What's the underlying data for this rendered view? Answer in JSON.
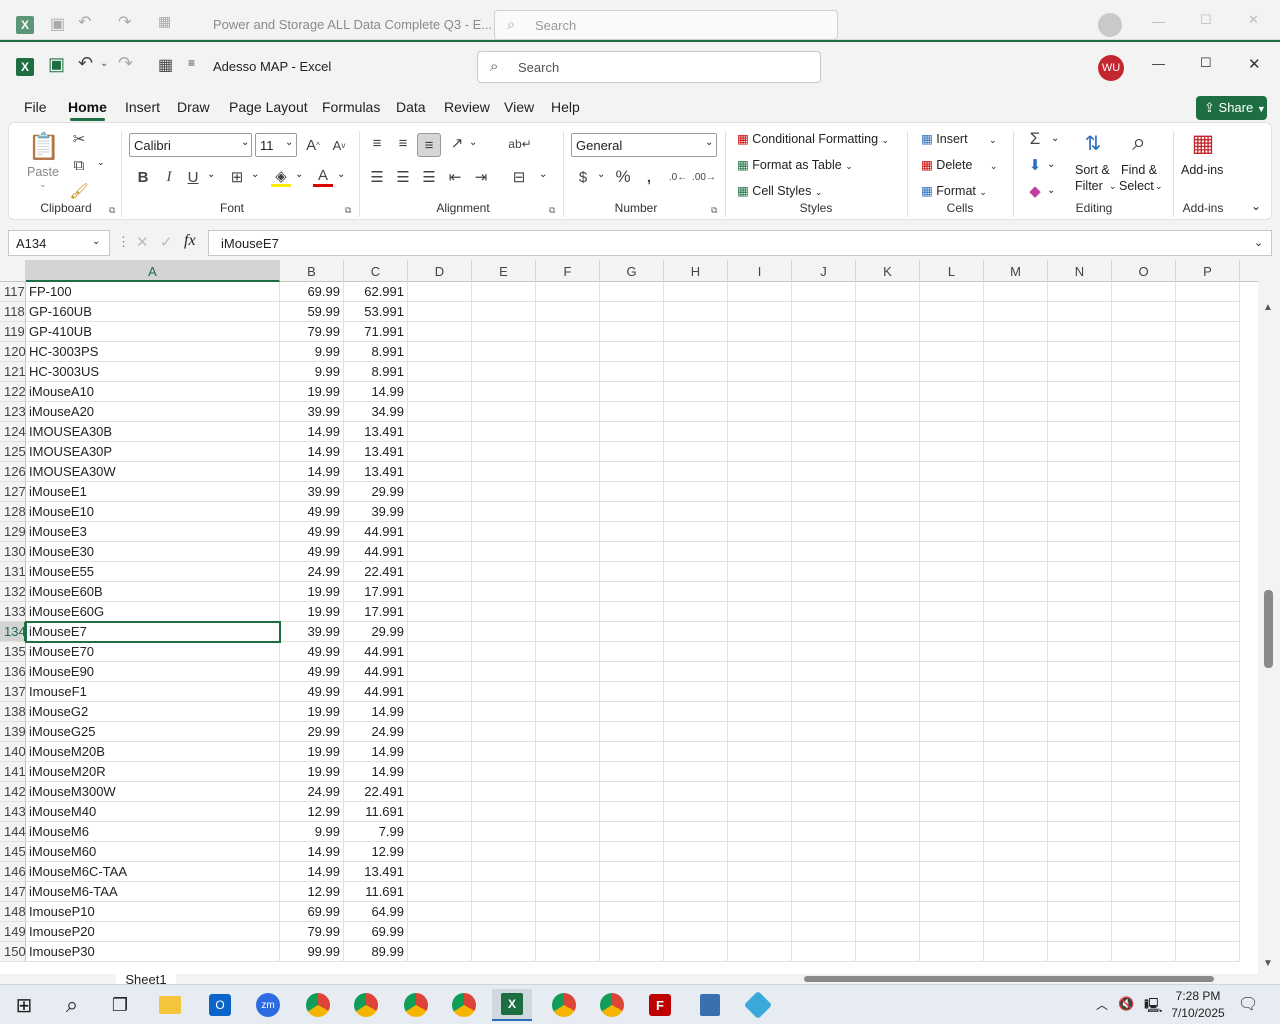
{
  "background_window": {
    "title": "Power and Storage ALL Data Complete Q3 - E...",
    "search_placeholder": "Search"
  },
  "window": {
    "doc_title": "Adesso MAP  -  Excel",
    "search_placeholder": "Search",
    "user_initials": "WU",
    "share_label": "Share"
  },
  "ribbon_tabs": [
    "File",
    "Home",
    "Insert",
    "Draw",
    "Page Layout",
    "Formulas",
    "Data",
    "Review",
    "View",
    "Help"
  ],
  "active_tab": "Home",
  "ribbon": {
    "clipboard": {
      "paste": "Paste",
      "group": "Clipboard"
    },
    "font": {
      "name": "Calibri",
      "size": "11",
      "group": "Font"
    },
    "alignment": {
      "group": "Alignment"
    },
    "number": {
      "format": "General",
      "group": "Number"
    },
    "styles": {
      "conditional": "Conditional Formatting",
      "format_table": "Format as Table",
      "cell_styles": "Cell Styles",
      "group": "Styles"
    },
    "cells": {
      "insert": "Insert",
      "delete": "Delete",
      "format": "Format",
      "group": "Cells"
    },
    "editing": {
      "sort1": "Sort &",
      "sort2": "Filter",
      "find1": "Find &",
      "find2": "Select",
      "group": "Editing"
    },
    "addins": {
      "label": "Add-ins",
      "group": "Add-ins"
    }
  },
  "formula_bar": {
    "name_box": "A134",
    "formula": "iMouseE7",
    "fx": "fx"
  },
  "columns": [
    "A",
    "B",
    "C",
    "D",
    "E",
    "F",
    "G",
    "H",
    "I",
    "J",
    "K",
    "L",
    "M",
    "N",
    "O",
    "P"
  ],
  "selected_cell": "A134",
  "rows": [
    {
      "n": "117",
      "a": "FP-100",
      "b": "69.99",
      "c": "62.991"
    },
    {
      "n": "118",
      "a": "GP-160UB",
      "b": "59.99",
      "c": "53.991"
    },
    {
      "n": "119",
      "a": "GP-410UB",
      "b": "79.99",
      "c": "71.991"
    },
    {
      "n": "120",
      "a": "HC-3003PS",
      "b": "9.99",
      "c": "8.991"
    },
    {
      "n": "121",
      "a": "HC-3003US",
      "b": "9.99",
      "c": "8.991"
    },
    {
      "n": "122",
      "a": "iMouseA10",
      "b": "19.99",
      "c": "14.99"
    },
    {
      "n": "123",
      "a": "iMouseA20",
      "b": "39.99",
      "c": "34.99"
    },
    {
      "n": "124",
      "a": "IMOUSEA30B",
      "b": "14.99",
      "c": "13.491"
    },
    {
      "n": "125",
      "a": "IMOUSEA30P",
      "b": "14.99",
      "c": "13.491"
    },
    {
      "n": "126",
      "a": "IMOUSEA30W",
      "b": "14.99",
      "c": "13.491"
    },
    {
      "n": "127",
      "a": "iMouseE1",
      "b": "39.99",
      "c": "29.99"
    },
    {
      "n": "128",
      "a": "iMouseE10",
      "b": "49.99",
      "c": "39.99"
    },
    {
      "n": "129",
      "a": "iMouseE3",
      "b": "49.99",
      "c": "44.991"
    },
    {
      "n": "130",
      "a": "iMouseE30",
      "b": "49.99",
      "c": "44.991"
    },
    {
      "n": "131",
      "a": "iMouseE55",
      "b": "24.99",
      "c": "22.491"
    },
    {
      "n": "132",
      "a": "iMouseE60B",
      "b": "19.99",
      "c": "17.991"
    },
    {
      "n": "133",
      "a": "iMouseE60G",
      "b": "19.99",
      "c": "17.991"
    },
    {
      "n": "134",
      "a": "iMouseE7",
      "b": "39.99",
      "c": "29.99"
    },
    {
      "n": "135",
      "a": "iMouseE70",
      "b": "49.99",
      "c": "44.991"
    },
    {
      "n": "136",
      "a": "iMouseE90",
      "b": "49.99",
      "c": "44.991"
    },
    {
      "n": "137",
      "a": "ImouseF1",
      "b": "49.99",
      "c": "44.991"
    },
    {
      "n": "138",
      "a": "iMouseG2",
      "b": "19.99",
      "c": "14.99"
    },
    {
      "n": "139",
      "a": "iMouseG25",
      "b": "29.99",
      "c": "24.99"
    },
    {
      "n": "140",
      "a": "iMouseM20B",
      "b": "19.99",
      "c": "14.99"
    },
    {
      "n": "141",
      "a": "iMouseM20R",
      "b": "19.99",
      "c": "14.99"
    },
    {
      "n": "142",
      "a": "iMouseM300W",
      "b": "24.99",
      "c": "22.491"
    },
    {
      "n": "143",
      "a": "iMouseM40",
      "b": "12.99",
      "c": "11.691"
    },
    {
      "n": "144",
      "a": "iMouseM6",
      "b": "9.99",
      "c": "7.99"
    },
    {
      "n": "145",
      "a": "iMouseM60",
      "b": "14.99",
      "c": "12.99"
    },
    {
      "n": "146",
      "a": "iMouseM6C-TAA",
      "b": "14.99",
      "c": "13.491"
    },
    {
      "n": "147",
      "a": "iMouseM6-TAA",
      "b": "12.99",
      "c": "11.691"
    },
    {
      "n": "148",
      "a": "ImouseP10",
      "b": "69.99",
      "c": "64.99"
    },
    {
      "n": "149",
      "a": "ImouseP20",
      "b": "79.99",
      "c": "69.99"
    },
    {
      "n": "150",
      "a": "ImouseP30",
      "b": "99.99",
      "c": "89.99"
    }
  ],
  "sheet_tab": "Sheet1",
  "taskbar": {
    "time": "7:28 PM",
    "date": "7/10/2025"
  },
  "accent_color": "#1d6f42"
}
